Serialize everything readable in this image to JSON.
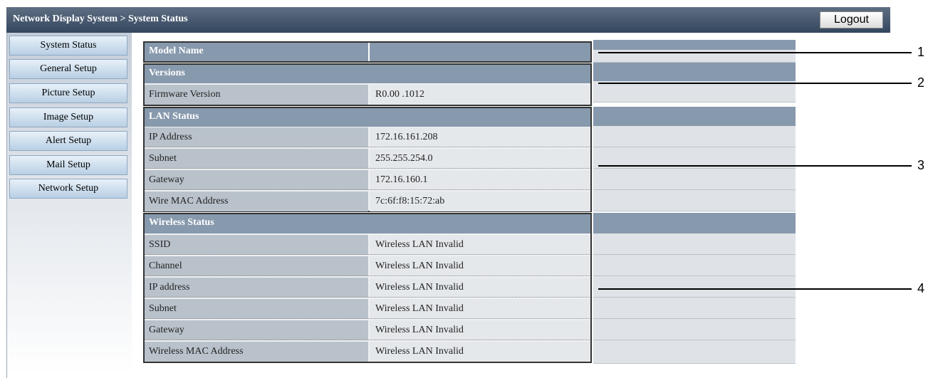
{
  "header": {
    "title": "Network Display System > System Status",
    "logout_label": "Logout"
  },
  "sidebar": {
    "items": [
      {
        "label": "System Status"
      },
      {
        "label": "General Setup"
      },
      {
        "label": "Picture Setup"
      },
      {
        "label": "Image Setup"
      },
      {
        "label": "Alert Setup"
      },
      {
        "label": "Mail Setup"
      },
      {
        "label": "Network Setup"
      }
    ]
  },
  "model": {
    "label": "Model Name",
    "value": ""
  },
  "versions": {
    "header": "Versions",
    "firmware_label": "Firmware Version",
    "firmware_value": "R0.00 .1012"
  },
  "lan": {
    "header": "LAN Status",
    "rows": [
      {
        "label": "IP Address",
        "value": "172.16.161.208"
      },
      {
        "label": "Subnet",
        "value": "255.255.254.0"
      },
      {
        "label": "Gateway",
        "value": "172.16.160.1"
      },
      {
        "label": "Wire MAC Address",
        "value": "7c:6f:f8:15:72:ab"
      }
    ]
  },
  "wireless": {
    "header": "Wireless Status",
    "rows": [
      {
        "label": "SSID",
        "value": "Wireless LAN Invalid"
      },
      {
        "label": "Channel",
        "value": "Wireless LAN Invalid"
      },
      {
        "label": "IP address",
        "value": "Wireless LAN Invalid"
      },
      {
        "label": "Subnet",
        "value": "Wireless LAN Invalid"
      },
      {
        "label": "Gateway",
        "value": "Wireless LAN Invalid"
      },
      {
        "label": "Wireless MAC Address",
        "value": "Wireless LAN Invalid"
      }
    ]
  },
  "callouts": [
    "1",
    "2",
    "3",
    "4"
  ]
}
